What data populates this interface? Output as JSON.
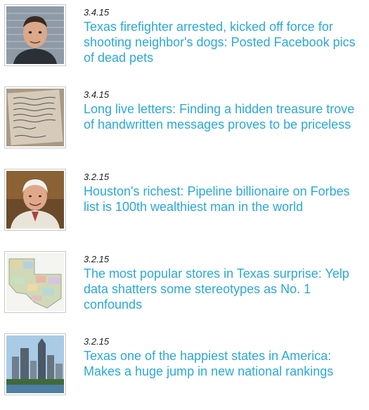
{
  "colors": {
    "link": "#2aa9d8",
    "date": "#222222",
    "thumb_border": "#c8c8c8"
  },
  "articles": [
    {
      "date": "3.4.15",
      "headline": "Texas firefighter arrested, kicked off force for shooting neighbor's dogs: Posted Facebook pics of dead pets",
      "thumbnail": "mugshot-photo"
    },
    {
      "date": "3.4.15",
      "headline": "Long live letters: Finding a hidden treasure trove of handwritten messages proves to be priceless",
      "thumbnail": "handwritten-letter-photo"
    },
    {
      "date": "3.2.15",
      "headline": "Houston's richest: Pipeline billionaire on Forbes list is 100th wealthiest man in the world",
      "thumbnail": "billionaire-portrait-photo"
    },
    {
      "date": "3.2.15",
      "headline": "The most popular stores in Texas surprise: Yelp data shatters some stereotypes as No. 1 confounds",
      "thumbnail": "texas-map-photo"
    },
    {
      "date": "3.2.15",
      "headline": "Texas one of the happiest states in America: Makes a huge jump in new national rankings",
      "thumbnail": "austin-skyline-photo"
    }
  ]
}
